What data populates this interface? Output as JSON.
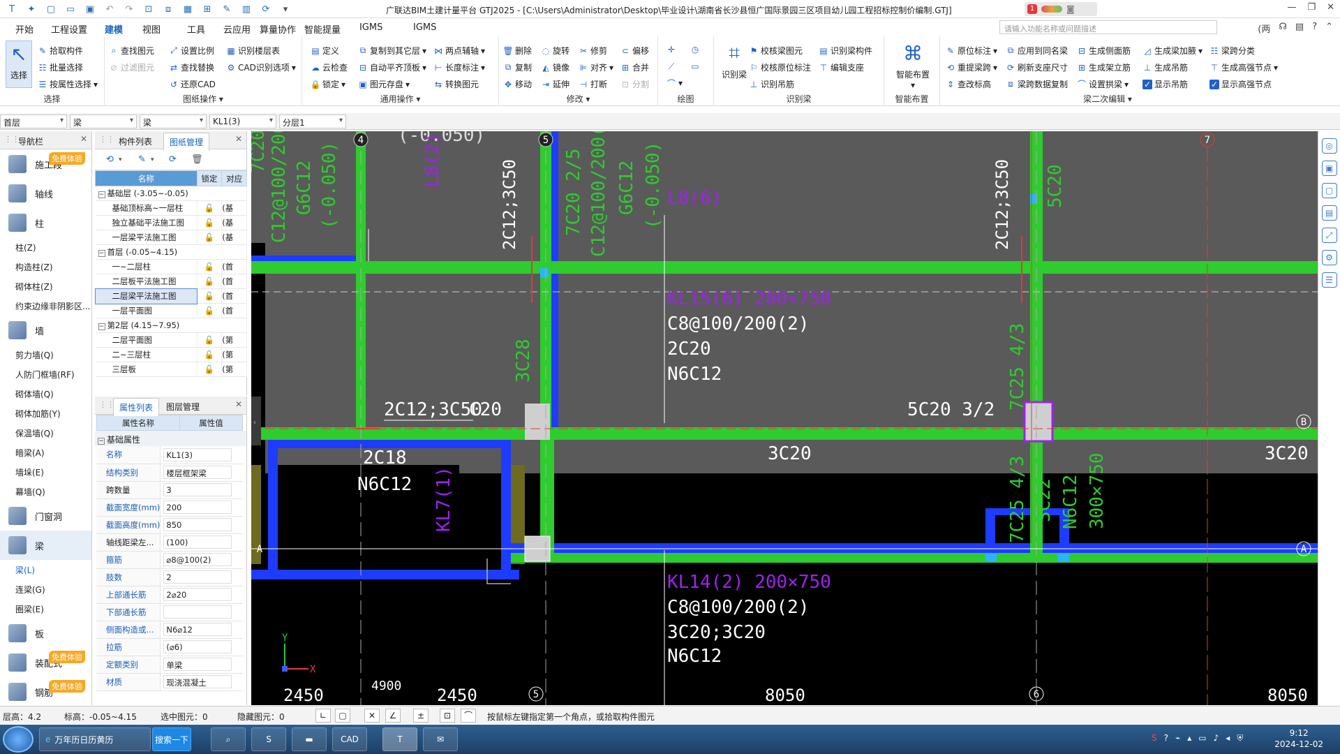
{
  "title_bar": {
    "quick_access": [
      "app-logo-icon",
      "file-icon",
      "new-icon",
      "open-icon",
      "save-icon",
      "undo-icon",
      "redo-icon",
      "icon-a",
      "icon-b",
      "icon-c",
      "icon-d",
      "icon-e",
      "icon-f",
      "icon-g",
      "dropdown-icon"
    ],
    "title": "广联达BIM土建计量平台 GTJ2025 - [C:\\Users\\Administrator\\Desktop\\毕业设计\\湖南省长沙县恒广国际景园三区项目幼儿园工程招标控制价编制.GTJ]",
    "notification_count": "1"
  },
  "menu": {
    "items": [
      "开始",
      "工程设置",
      "建模",
      "视图",
      "工具",
      "云应用",
      "算量协作",
      "智能提量",
      "IGMS"
    ],
    "active_index": 2,
    "search_placeholder": "请输入功能名称或问题描述",
    "right_label": "(两",
    "help": "?"
  },
  "ribbon": {
    "select": {
      "big_label": "选择",
      "items": [
        "拾取构件",
        "批量选择",
        "按属性选择"
      ],
      "label": "选择"
    },
    "drawing_ops": {
      "items": [
        "查找图元",
        "过滤图元",
        "设置比例",
        "查找替换",
        "还原CAD",
        "识别楼层表",
        "CAD识别选项"
      ],
      "label": "图纸操作"
    },
    "general_ops": {
      "items": [
        "定义",
        "云检查",
        "锁定",
        "复制到其它层",
        "自动平齐顶板",
        "图元存盘",
        "两点辅轴",
        "长度标注",
        "转换图元"
      ],
      "label": "通用操作"
    },
    "modify": {
      "items": [
        "删除",
        "复制",
        "移动",
        "旋转",
        "镜像",
        "延伸",
        "修剪",
        "对齐",
        "打断",
        "偏移",
        "合并",
        "分割"
      ],
      "label": "修改"
    },
    "draw": {
      "label": "绘图"
    },
    "recognize_beam": {
      "big_label": "识别梁",
      "items": [
        "校核梁图元",
        "校核原位标注",
        "识别吊筋",
        "识别梁构件",
        "编辑支座"
      ],
      "label": "识别梁"
    },
    "smart_layout": {
      "big_label": "智能布置",
      "label": "智能布置"
    },
    "beam_second_edit": {
      "items": [
        "原位标注",
        "重提梁跨",
        "查改标高",
        "应用到同名梁",
        "刷新支座尺寸",
        "梁跨数据复制",
        "生成侧面筋",
        "生成架立筋",
        "设置拱梁",
        "生成梁加腋",
        "生成吊筋",
        "显示吊筋",
        "梁跨分类",
        "生成高强节点",
        "显示高强节点"
      ],
      "label": "梁二次编辑"
    }
  },
  "selector_bar": {
    "floor": "首层",
    "category": "梁",
    "type": "梁",
    "component": "KL1(3)",
    "layer": "分层1"
  },
  "nav_panel": {
    "title": "导航栏",
    "free_badge": "免费体验",
    "items": [
      {
        "kind": "cat",
        "label": "施工段",
        "badge": true
      },
      {
        "kind": "cat",
        "label": "轴线"
      },
      {
        "kind": "cat",
        "label": "柱"
      },
      {
        "kind": "sub",
        "label": "柱(Z)"
      },
      {
        "kind": "sub",
        "label": "构造柱(Z)"
      },
      {
        "kind": "sub",
        "label": "砌体柱(Z)"
      },
      {
        "kind": "sub",
        "label": "约束边缘非阴影区..."
      },
      {
        "kind": "cat",
        "label": "墙"
      },
      {
        "kind": "sub",
        "label": "剪力墙(Q)"
      },
      {
        "kind": "sub",
        "label": "人防门框墙(RF)"
      },
      {
        "kind": "sub",
        "label": "砌体墙(Q)"
      },
      {
        "kind": "sub",
        "label": "砌体加筋(Y)"
      },
      {
        "kind": "sub",
        "label": "保温墙(Q)"
      },
      {
        "kind": "sub",
        "label": "暗梁(A)"
      },
      {
        "kind": "sub",
        "label": "墙垛(E)"
      },
      {
        "kind": "sub",
        "label": "幕墙(Q)"
      },
      {
        "kind": "cat",
        "label": "门窗洞"
      },
      {
        "kind": "cat",
        "label": "梁",
        "selected": true
      },
      {
        "kind": "sub",
        "label": "梁(L)",
        "selected": true
      },
      {
        "kind": "sub",
        "label": "连梁(G)"
      },
      {
        "kind": "sub",
        "label": "圈梁(E)"
      },
      {
        "kind": "cat",
        "label": "板"
      },
      {
        "kind": "cat",
        "label": "装配式",
        "badge": true
      },
      {
        "kind": "cat",
        "label": "钢筋",
        "badge": true
      }
    ]
  },
  "drawing_panel": {
    "tabs": [
      "构件列表",
      "图纸管理"
    ],
    "active_tab": 1,
    "columns": [
      "名称",
      "锁定",
      "对应"
    ],
    "rows": [
      {
        "type": "group",
        "name": "基础层 (-3.05~-0.05)"
      },
      {
        "type": "item",
        "name": "基础顶标高~一层柱",
        "extra": "(基"
      },
      {
        "type": "item",
        "name": "独立基础平法施工图",
        "extra": "(基"
      },
      {
        "type": "item",
        "name": "一层梁平法施工图",
        "extra": "(基"
      },
      {
        "type": "group",
        "name": "首层 (-0.05~4.15)"
      },
      {
        "type": "item",
        "name": "一~二层柱",
        "extra": "(首"
      },
      {
        "type": "item",
        "name": "二层板平法施工图",
        "extra": "(首"
      },
      {
        "type": "item",
        "name": "二层梁平法施工图",
        "extra": "(首",
        "selected": true
      },
      {
        "type": "item",
        "name": "一层平面图",
        "extra": "(首"
      },
      {
        "type": "group",
        "name": "第2层 (4.15~7.95)"
      },
      {
        "type": "item",
        "name": "二层平面图",
        "extra": "(第"
      },
      {
        "type": "item",
        "name": "二~三层柱",
        "extra": "(第"
      },
      {
        "type": "item",
        "name": "三层板",
        "extra": "(第"
      }
    ]
  },
  "props_panel": {
    "tabs": [
      "属性列表",
      "图层管理"
    ],
    "columns": [
      "属性名称",
      "属性值"
    ],
    "category": "基础属性",
    "rows": [
      {
        "k": "名称",
        "v": "KL1(3)",
        "blue": true
      },
      {
        "k": "结构类别",
        "v": "楼层框架梁",
        "blue": true
      },
      {
        "k": "跨数量",
        "v": "3"
      },
      {
        "k": "截面宽度(mm)",
        "v": "200",
        "blue": true
      },
      {
        "k": "截面高度(mm)",
        "v": "850",
        "blue": true
      },
      {
        "k": "轴线距梁左...",
        "v": "(100)"
      },
      {
        "k": "箍筋",
        "v": "⌀8@100(2)",
        "blue": true
      },
      {
        "k": "肢数",
        "v": "2",
        "blue": true
      },
      {
        "k": "上部通长筋",
        "v": "2⌀20",
        "blue": true
      },
      {
        "k": "下部通长筋",
        "v": "",
        "blue": true
      },
      {
        "k": "侧面构造或...",
        "v": "N6⌀12",
        "blue": true
      },
      {
        "k": "拉筋",
        "v": "(⌀6)",
        "blue": true
      },
      {
        "k": "定额类别",
        "v": "单梁",
        "blue": true
      },
      {
        "k": "材质",
        "v": "现浇混凝土",
        "blue": true
      }
    ]
  },
  "canvas": {
    "axis_labels": [
      "4",
      "5",
      "7",
      "5",
      "6",
      "B",
      "A",
      "A"
    ],
    "texts": {
      "top_val": "(-0.050)",
      "l1": "7C20 2/5",
      "l2": "C12@100/200(2)",
      "l3": "G6C12",
      "l4": "(-0.050)",
      "l8_left": "L8(2)",
      "l8_right": "L8(6)",
      "note1": "2C12;3C50",
      "note2": "2C12;3C50",
      "kl15": "KL15(6) 200×750",
      "kl15_a": "C8@100/200(2)",
      "kl15_b": "2C20",
      "kl15_c": "N6C12",
      "c3c28": "3C28",
      "right_5c20": "5C20",
      "mid_2c12": "2C12;3C50",
      "mid_c20": "C20",
      "mid_5c20": "5C20 3/2",
      "mid_3c20a": "3C20",
      "mid_3c20b": "3C20",
      "v7c25a": "7C25 4/3",
      "v7c25b": "7C25 4/3",
      "v3c22": "3C22",
      "vn6c12": "N6C12",
      "v300": "300×750",
      "c2c18": "2C18",
      "n6c12": "N6C12",
      "kl7": "KL7(1)",
      "kl14": "KL14(2) 200×750",
      "kl14_a": "C8@100/200(2)",
      "kl14_b": "3C20;3C20",
      "kl14_c": "N6C12",
      "dim1": "2450",
      "dim2": "4900",
      "dim3": "2450",
      "dim4": "8050",
      "dim5": "8050",
      "axis_y": "Y",
      "axis_x": "X"
    }
  },
  "status_bar": {
    "floor_height": "层高：4.2",
    "elevation": "标高：-0.05~4.15",
    "selected": "选中图元：0",
    "hidden": "隐藏图元：0",
    "hint": "按鼠标左键指定第一个角点，或拾取构件图元"
  },
  "taskbar": {
    "app1": "万年历日历黄历",
    "search_btn": "搜索一下",
    "time": "9:12",
    "date": "2024-12-02"
  },
  "colors": {
    "beam_green": "#2ecc2e",
    "beam_blue": "#1e3cff",
    "canvas_bg": "#5a5a5a",
    "accent": "#1565c0"
  }
}
